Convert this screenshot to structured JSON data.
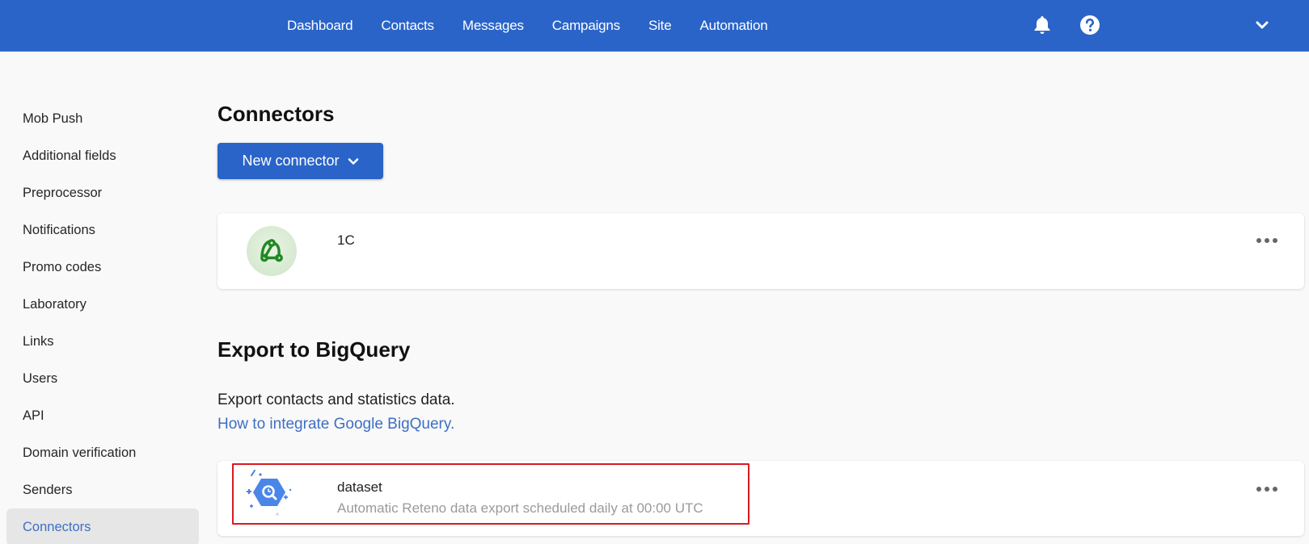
{
  "topbar": {
    "nav": [
      "Dashboard",
      "Contacts",
      "Messages",
      "Campaigns",
      "Site",
      "Automation"
    ],
    "icons": [
      "bell-icon",
      "help-icon",
      "chevron-down-icon"
    ],
    "brand_color": "#2a64c8"
  },
  "sidebar": {
    "items": [
      {
        "label": "Mob Push",
        "active": false
      },
      {
        "label": "Additional fields",
        "active": false
      },
      {
        "label": "Preprocessor",
        "active": false
      },
      {
        "label": "Notifications",
        "active": false
      },
      {
        "label": "Promo codes",
        "active": false
      },
      {
        "label": "Laboratory",
        "active": false
      },
      {
        "label": "Links",
        "active": false
      },
      {
        "label": "Users",
        "active": false
      },
      {
        "label": "API",
        "active": false
      },
      {
        "label": "Domain verification",
        "active": false
      },
      {
        "label": "Senders",
        "active": false
      },
      {
        "label": "Connectors",
        "active": true
      }
    ]
  },
  "main": {
    "title": "Connectors",
    "new_connector_label": "New connector",
    "connectors": [
      {
        "name": "1C",
        "icon": "webhook-icon"
      }
    ],
    "bigquery": {
      "title": "Export to BigQuery",
      "description": "Export contacts and statistics data.",
      "link_label": "How to integrate Google BigQuery.",
      "item": {
        "name": "dataset",
        "subtitle": "Automatic Reteno data export scheduled daily at 00:00 UTC",
        "icon": "bigquery-icon",
        "highlighted": true,
        "highlight_color": "#d81b22"
      }
    }
  }
}
